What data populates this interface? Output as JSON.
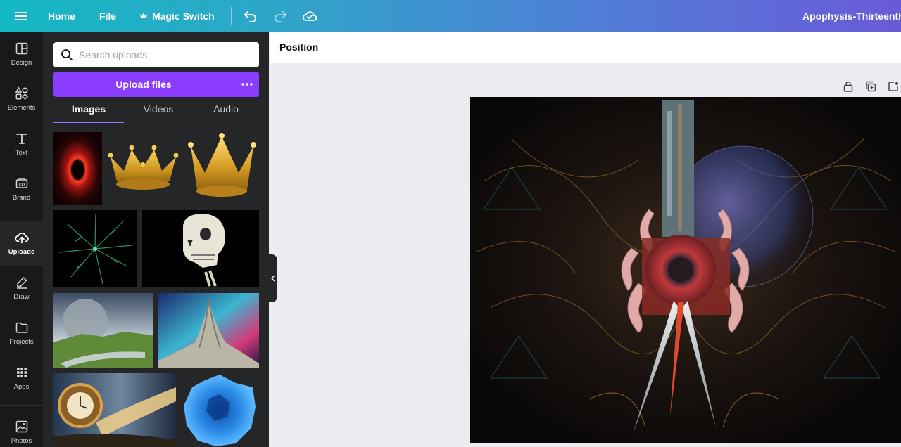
{
  "topbar": {
    "home_label": "Home",
    "file_label": "File",
    "magic_switch_label": "Magic Switch",
    "doc_title": "Apophysis-ThirteenthD"
  },
  "rail": {
    "items": [
      {
        "label": "Design",
        "icon": "design-icon"
      },
      {
        "label": "Elements",
        "icon": "elements-icon"
      },
      {
        "label": "Text",
        "icon": "text-icon"
      },
      {
        "label": "Brand",
        "icon": "brand-icon"
      },
      {
        "label": "Uploads",
        "icon": "uploads-icon"
      },
      {
        "label": "Draw",
        "icon": "draw-icon"
      },
      {
        "label": "Projects",
        "icon": "projects-icon"
      },
      {
        "label": "Apps",
        "icon": "apps-icon"
      },
      {
        "label": "Photos",
        "icon": "photos-icon"
      }
    ],
    "active": "Uploads"
  },
  "panel": {
    "search_placeholder": "Search uploads",
    "upload_label": "Upload files",
    "tabs": [
      "Images",
      "Videos",
      "Audio"
    ],
    "active_tab": "Images",
    "thumbnails": [
      "red-eclipse-image",
      "gold-crown-image",
      "gold-crown-tall-image",
      "green-fractal-image",
      "skull-image",
      "moon-landscape-image",
      "cosmic-mountain-image",
      "clock-fantasy-image",
      "blue-rose-image"
    ]
  },
  "context_bar": {
    "position_label": "Position"
  },
  "canvas": {
    "artwork": "fractal-artwork"
  },
  "colors": {
    "accent": "#8b3dff",
    "rail_bg": "#18191b",
    "panel_bg": "#252627",
    "workspace_bg": "#ebecf0"
  }
}
